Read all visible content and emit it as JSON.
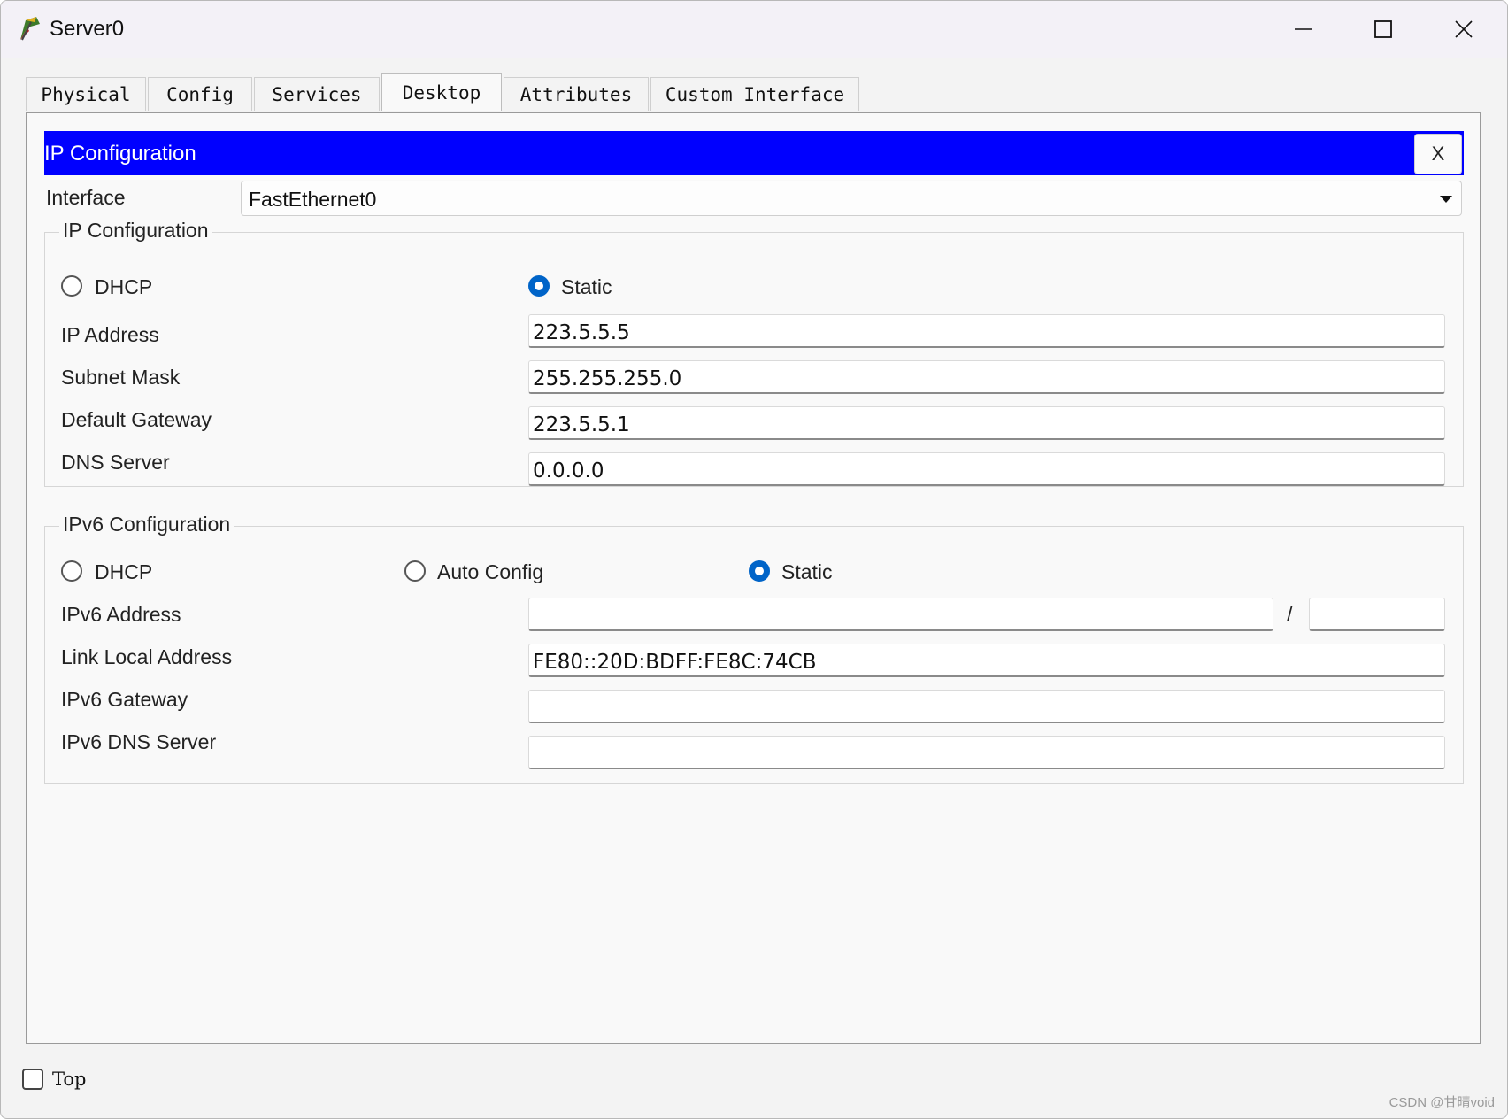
{
  "window": {
    "title": "Server0",
    "icon": "server-app-icon"
  },
  "window_controls": {
    "minimize": "minimize-icon",
    "maximize": "maximize-icon",
    "close": "close-icon"
  },
  "tabs": [
    {
      "label": "Physical"
    },
    {
      "label": "Config"
    },
    {
      "label": "Services"
    },
    {
      "label": "Desktop",
      "active": true
    },
    {
      "label": "Attributes"
    },
    {
      "label": "Custom Interface"
    }
  ],
  "dialog": {
    "title": "IP Configuration",
    "close_label": "X",
    "header_color": "#0000ff"
  },
  "interface": {
    "label": "Interface",
    "value": "FastEthernet0"
  },
  "ipv4": {
    "title": "IP Configuration",
    "dhcp_label": "DHCP",
    "static_label": "Static",
    "mode": "Static",
    "ip_label": "IP Address",
    "ip_value": "223.5.5.5",
    "mask_label": "Subnet Mask",
    "mask_value": "255.255.255.0",
    "gateway_label": "Default Gateway",
    "gateway_value": "223.5.5.1",
    "dns_label": "DNS Server",
    "dns_value": "0.0.0.0"
  },
  "ipv6": {
    "title": "IPv6 Configuration",
    "dhcp_label": "DHCP",
    "auto_label": "Auto Config",
    "static_label": "Static",
    "mode": "Static",
    "address_label": "IPv6 Address",
    "address_value": "",
    "prefix_value": "",
    "slash": "/",
    "link_local_label": "Link Local Address",
    "link_local_value": "FE80::20D:BDFF:FE8C:74CB",
    "gateway_label": "IPv6 Gateway",
    "gateway_value": "",
    "dns_label": "IPv6 DNS Server",
    "dns_value": ""
  },
  "footer": {
    "top_label": "Top",
    "top_checked": false
  },
  "watermark": "CSDN @甘晴void",
  "colors": {
    "accent": "#0064c8",
    "header": "#0000ff"
  }
}
